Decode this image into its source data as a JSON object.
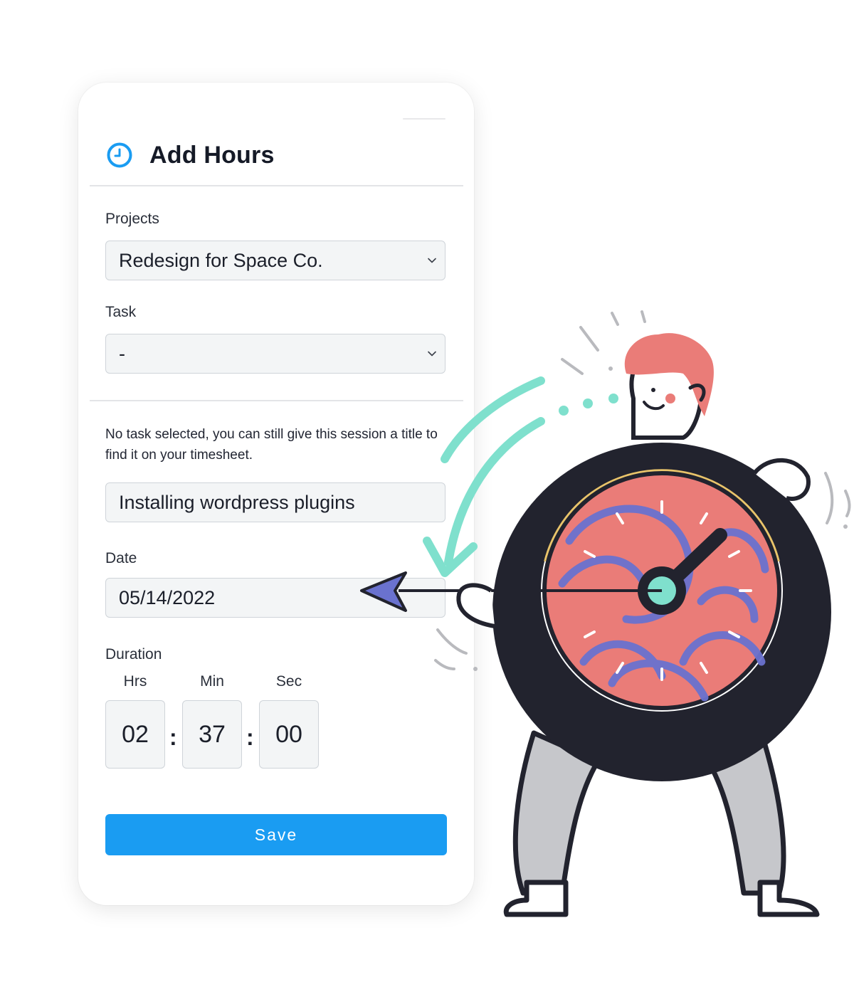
{
  "form": {
    "title": "Add Hours",
    "header_icon": "clock-icon",
    "projects": {
      "label": "Projects",
      "value": "Redesign for Space Co."
    },
    "task": {
      "label": "Task",
      "value": "-"
    },
    "note": "No task selected, you can still give this session a title to find it on your timesheet.",
    "session_title": {
      "value": "Installing wordpress plugins"
    },
    "date": {
      "label": "Date",
      "value": "05/14/2022"
    },
    "duration": {
      "label": "Duration",
      "hours_label": "Hrs",
      "minutes_label": "Min",
      "seconds_label": "Sec",
      "hours": "02",
      "minutes": "37",
      "seconds": "00",
      "separator": ":"
    },
    "save_label": "Save"
  },
  "colors": {
    "accent": "#1a9cf2",
    "field_bg": "#f3f5f6",
    "field_border": "#cfd4d9",
    "illustration_teal": "#7fe0cd",
    "illustration_coral": "#ea7c78",
    "illustration_purple": "#6a72cf",
    "illustration_dark": "#22232e"
  }
}
